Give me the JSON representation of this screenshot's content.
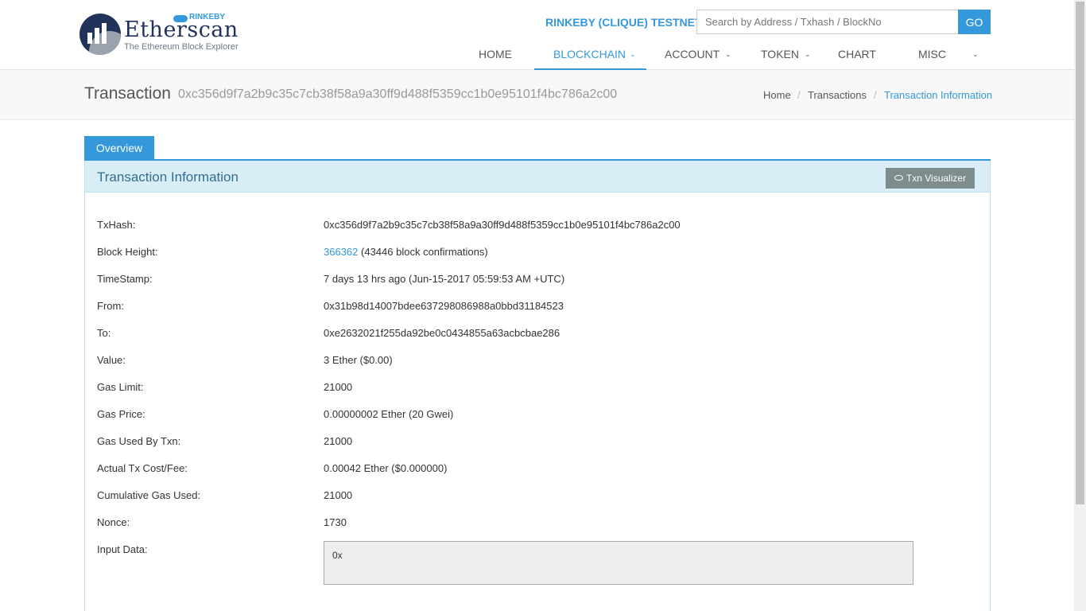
{
  "brand": {
    "wordmark": "Etherscan",
    "tagline": "The Ethereum Block Explorer",
    "network_badge": "RINKEBY"
  },
  "header": {
    "network_label": "RINKEBY (CLIQUE) TESTNET",
    "search_placeholder": "Search by Address / Txhash / BlockNo",
    "go_label": "GO"
  },
  "nav": [
    {
      "label": "HOME",
      "dropdown": false,
      "active": false
    },
    {
      "label": "BLOCKCHAIN",
      "dropdown": true,
      "active": true
    },
    {
      "label": "ACCOUNT",
      "dropdown": true,
      "active": false
    },
    {
      "label": "TOKEN",
      "dropdown": true,
      "active": false
    },
    {
      "label": "CHART",
      "dropdown": false,
      "active": false
    },
    {
      "label": "MISC",
      "dropdown": true,
      "active": false
    }
  ],
  "page": {
    "title": "Transaction",
    "hash": "0xc356d9f7a2b9c35c7cb38f58a9a30ff9d488f5359cc1b0e95101f4bc786a2c00"
  },
  "breadcrumb": [
    "Home",
    "Transactions",
    "Transaction Information"
  ],
  "tabs": [
    {
      "label": "Overview",
      "active": true
    }
  ],
  "panel": {
    "title": "Transaction Information",
    "visualizer_label": "Txn Visualizer"
  },
  "fields": {
    "txhash": {
      "label": "TxHash:",
      "value": "0xc356d9f7a2b9c35c7cb38f58a9a30ff9d488f5359cc1b0e95101f4bc786a2c00"
    },
    "block_height": {
      "label": "Block Height:",
      "block": "366362",
      "confirmations": "(43446 block confirmations)"
    },
    "timestamp": {
      "label": "TimeStamp:",
      "value": "7 days 13 hrs ago (Jun-15-2017 05:59:53 AM +UTC)"
    },
    "from": {
      "label": "From:",
      "value": "0x31b98d14007bdee637298086988a0bbd31184523"
    },
    "to": {
      "label": "To:",
      "value": "0xe2632021f255da92be0c0434855a63acbcbae286"
    },
    "value": {
      "label": "Value:",
      "value": "3 Ether ($0.00)"
    },
    "gas_limit": {
      "label": "Gas Limit:",
      "value": "21000"
    },
    "gas_price": {
      "label": "Gas Price:",
      "value": "0.00000002 Ether (20 Gwei)"
    },
    "gas_used": {
      "label": "Gas Used By Txn:",
      "value": "21000"
    },
    "tx_fee": {
      "label": "Actual Tx Cost/Fee:",
      "value": "0.00042 Ether ($0.000000)"
    },
    "cumulative_gas": {
      "label": "Cumulative Gas Used:",
      "value": "21000"
    },
    "nonce": {
      "label": "Nonce:",
      "value": "1730"
    },
    "input_data": {
      "label": "Input Data:",
      "value": "0x"
    }
  },
  "colors": {
    "accent": "#3498db",
    "brand_dark": "#21325b",
    "panel_head": "#d9edf7",
    "panel_title": "#31708f",
    "button_gray": "#7f8c8d"
  }
}
